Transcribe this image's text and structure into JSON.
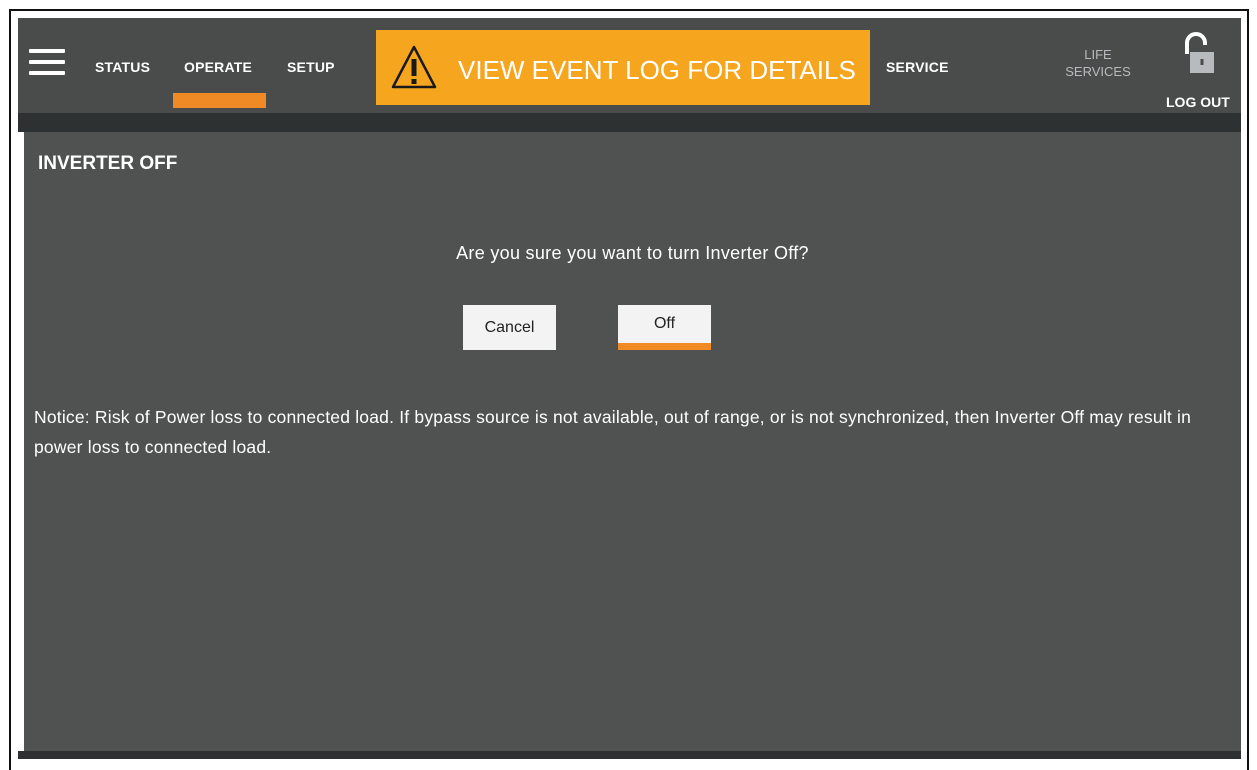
{
  "nav": {
    "status": "STATUS",
    "operate": "OPERATE",
    "setup": "SETUP",
    "service": "SERVICE",
    "life_services_line1": "LIFE",
    "life_services_line2": "SERVICES",
    "logout": "LOG OUT",
    "active": "OPERATE"
  },
  "alert": {
    "text": "VIEW EVENT LOG FOR DETAILS",
    "icon": "warning-triangle-icon"
  },
  "panel": {
    "title": "INVERTER OFF",
    "question": "Are you sure you want to turn Inverter Off?",
    "cancel_label": "Cancel",
    "off_label": "Off",
    "notice": "Notice: Risk of Power loss to connected load. If bypass source is not available, out of range, or is not synchronized, then Inverter Off may result in power loss to connected load."
  },
  "colors": {
    "accent": "#f08a24",
    "alert_bg": "#f6a51f",
    "topbar_bg": "#4a4c4c",
    "panel_bg": "#505252"
  }
}
